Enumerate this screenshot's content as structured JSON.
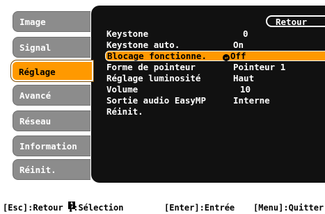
{
  "tabs": [
    {
      "label": "Image"
    },
    {
      "label": "Signal"
    },
    {
      "label": "Réglage"
    },
    {
      "label": "Avancé"
    },
    {
      "label": "Réseau"
    },
    {
      "label": "Information"
    },
    {
      "label": "Réinit."
    }
  ],
  "selected_tab": "Réglage",
  "panel": {
    "back_label": "Retour",
    "items": [
      {
        "label": "Keystone",
        "value": "0"
      },
      {
        "label": "Keystone auto.",
        "value": "On"
      },
      {
        "label": "Blocage fonctionne.",
        "value": "Off"
      },
      {
        "label": "Forme de pointeur",
        "value": "Pointeur 1"
      },
      {
        "label": "Réglage luminosité",
        "value": "Haut"
      },
      {
        "label": "Volume",
        "value": "10"
      },
      {
        "label": "Sortie audio EasyMP",
        "value": "Interne"
      },
      {
        "label": "Réinit.",
        "value": ""
      }
    ]
  },
  "statusbar": {
    "esc": "[Esc]:Retour",
    "select_prefix": "[",
    "select_suffix": "]:Sélection",
    "enter": "[Enter]:Entrée",
    "menu": "[Menu]:Quitter"
  },
  "colors": {
    "accent": "#ff9900",
    "tab_bg": "#8c8c8c",
    "panel_bg": "#111111"
  },
  "icons": {
    "enter": "enter-icon",
    "select": "up-down-arrows-icon"
  }
}
